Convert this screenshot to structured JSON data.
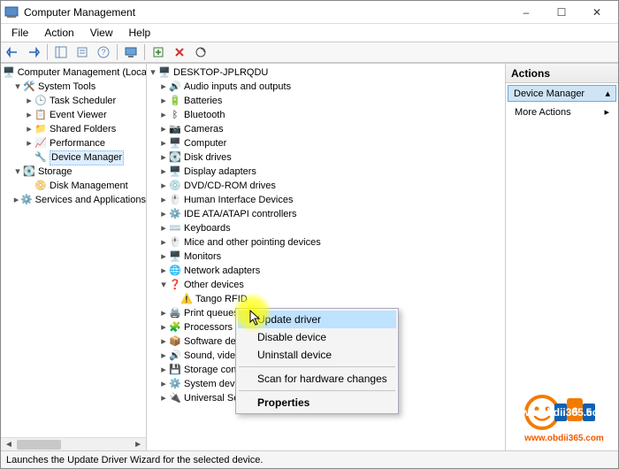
{
  "window": {
    "title": "Computer Management",
    "buttons": {
      "min": "–",
      "max": "☐",
      "close": "✕"
    }
  },
  "menubar": [
    "File",
    "Action",
    "View",
    "Help"
  ],
  "scope": {
    "root": "Computer Management (Local)",
    "sys_tools": "System Tools",
    "task_scheduler": "Task Scheduler",
    "event_viewer": "Event Viewer",
    "shared_folders": "Shared Folders",
    "performance": "Performance",
    "device_manager": "Device Manager",
    "storage": "Storage",
    "disk_management": "Disk Management",
    "services": "Services and Applications"
  },
  "devmgr": {
    "root": "DESKTOP-JPLRQDU",
    "items": [
      "Audio inputs and outputs",
      "Batteries",
      "Bluetooth",
      "Cameras",
      "Computer",
      "Disk drives",
      "Display adapters",
      "DVD/CD-ROM drives",
      "Human Interface Devices",
      "IDE ATA/ATAPI controllers",
      "Keyboards",
      "Mice and other pointing devices",
      "Monitors",
      "Network adapters"
    ],
    "other_devices": "Other devices",
    "rfid": "Tango RFID",
    "trailing": [
      "Print queues",
      "Processors",
      "Software devices",
      "Sound, video and game controllers",
      "Storage controllers",
      "System devices",
      "Universal Serial Bus controllers"
    ]
  },
  "context_menu": {
    "update": "Update driver",
    "disable": "Disable device",
    "uninstall": "Uninstall device",
    "scan": "Scan for hardware changes",
    "properties": "Properties"
  },
  "actions": {
    "header": "Actions",
    "selection": "Device Manager",
    "more": "More Actions"
  },
  "statusbar": "Launches the Update Driver Wizard for the selected device.",
  "watermark": {
    "url": "www.obdii365.com"
  }
}
